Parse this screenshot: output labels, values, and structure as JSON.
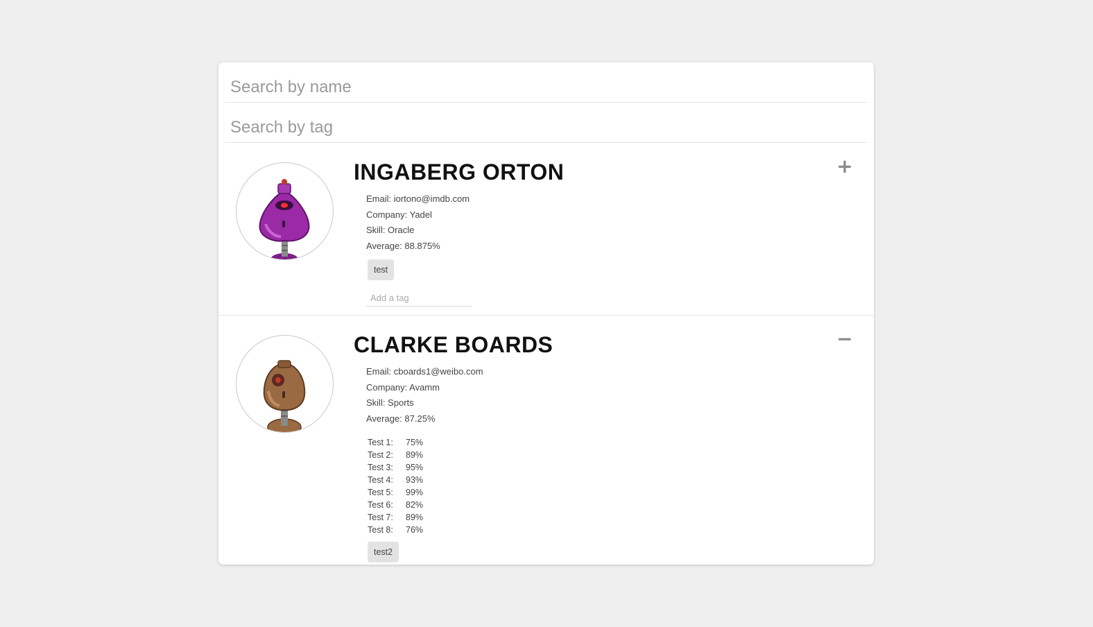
{
  "search": {
    "name_placeholder": "Search by name",
    "tag_placeholder": "Search by tag"
  },
  "students": [
    {
      "name": "INGABERG ORTON",
      "email": "Email: iortono@imdb.com",
      "company": "Company: Yadel",
      "skill": "Skill: Oracle",
      "average": "Average: 88.875%",
      "expanded": false,
      "toggle_symbol": "+",
      "avatar_color": "#9b2aa6",
      "tags": [
        "test"
      ],
      "tag_placeholder": "Add a tag"
    },
    {
      "name": "CLARKE BOARDS",
      "email": "Email: cboards1@weibo.com",
      "company": "Company: Avamm",
      "skill": "Skill: Sports",
      "average": "Average: 87.25%",
      "expanded": true,
      "toggle_symbol": "−",
      "avatar_color": "#9a6a43",
      "grades": [
        {
          "label": "Test 1:",
          "value": "75%"
        },
        {
          "label": "Test 2:",
          "value": "89%"
        },
        {
          "label": "Test 3:",
          "value": "95%"
        },
        {
          "label": "Test 4:",
          "value": "93%"
        },
        {
          "label": "Test 5:",
          "value": "99%"
        },
        {
          "label": "Test 6:",
          "value": "82%"
        },
        {
          "label": "Test 7:",
          "value": "89%"
        },
        {
          "label": "Test 8:",
          "value": "76%"
        }
      ],
      "tags": [
        "test2"
      ]
    }
  ]
}
